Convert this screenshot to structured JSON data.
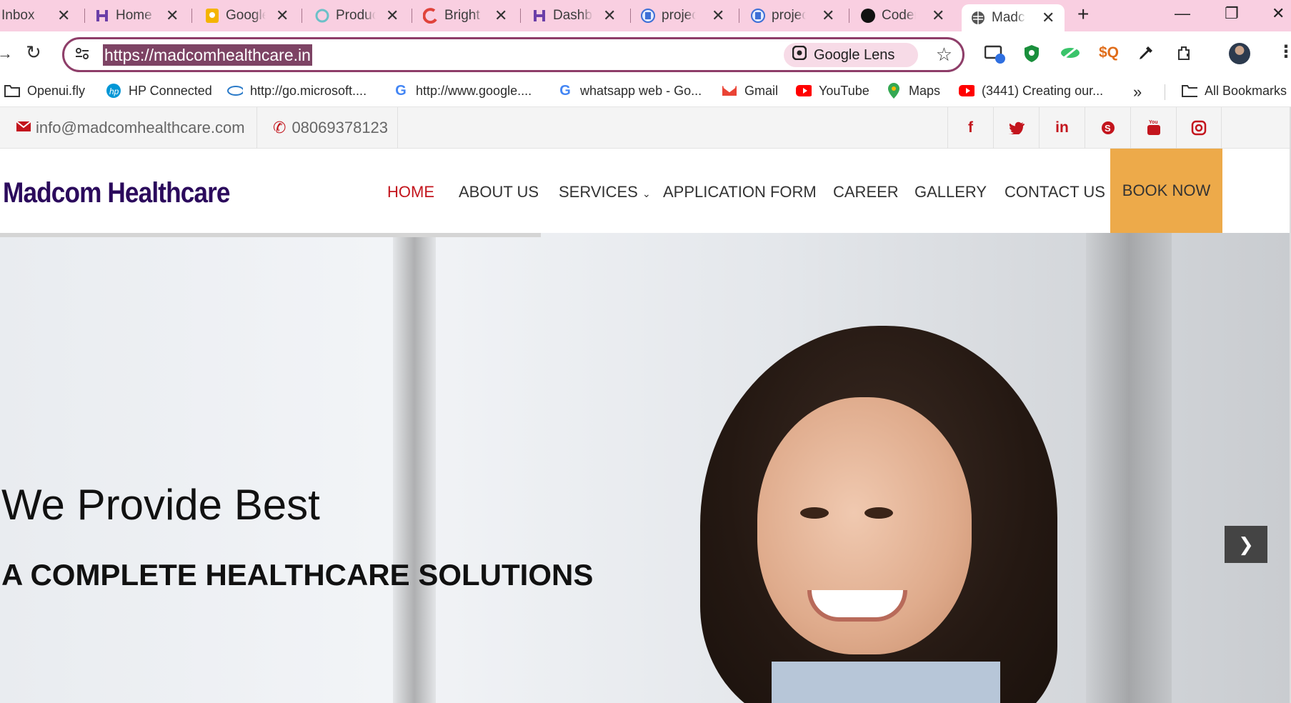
{
  "tabs": [
    {
      "title": "Inbox",
      "icon": "gmail-icon"
    },
    {
      "title": "Home",
      "icon": "home-app-icon"
    },
    {
      "title": "Google",
      "icon": "google-keep-icon"
    },
    {
      "title": "Products",
      "icon": "products-icon"
    },
    {
      "title": "Bright",
      "icon": "bright-icon"
    },
    {
      "title": "Dashboard",
      "icon": "dashboard-icon"
    },
    {
      "title": "project",
      "icon": "project-icon"
    },
    {
      "title": "project",
      "icon": "project-icon"
    },
    {
      "title": "Coder",
      "icon": "coder-icon"
    },
    {
      "title": "Madcom",
      "icon": "globe-icon"
    }
  ],
  "address": {
    "url": "https://madcomhealthcare.in",
    "lens_label": "Google Lens"
  },
  "bookmarks": [
    {
      "label": "Openui.fly",
      "icon": "folder-icon"
    },
    {
      "label": "HP Connected",
      "icon": "hp-icon"
    },
    {
      "label": "http://go.microsoft....",
      "icon": "msn-icon"
    },
    {
      "label": "http://www.google....",
      "icon": "google-icon"
    },
    {
      "label": "whatsapp web - Go...",
      "icon": "google-icon"
    },
    {
      "label": "Gmail",
      "icon": "gmail-icon"
    },
    {
      "label": "YouTube",
      "icon": "youtube-icon"
    },
    {
      "label": "Maps",
      "icon": "maps-icon"
    },
    {
      "label": "(3441) Creating our...",
      "icon": "youtube-icon"
    }
  ],
  "all_bookmarks": "All Bookmarks",
  "topbar": {
    "email": "info@madcomhealthcare.com",
    "phone": "08069378123"
  },
  "social": [
    {
      "label": "f",
      "icon": "facebook-icon"
    },
    {
      "label": "t",
      "icon": "twitter-icon"
    },
    {
      "label": "in",
      "icon": "linkedin-icon"
    },
    {
      "label": "S",
      "icon": "skype-icon"
    },
    {
      "label": "▶",
      "icon": "youtube-icon"
    },
    {
      "label": "◎",
      "icon": "instagram-icon"
    }
  ],
  "site": {
    "logo": "Madcom Healthcare",
    "book_now": "BOOK NOW"
  },
  "nav": [
    "HOME",
    "ABOUT US",
    "SERVICES",
    "APPLICATION FORM",
    "CAREER",
    "GALLERY",
    "CONTACT US"
  ],
  "hero": {
    "title": "We Provide Best",
    "subtitle": "A COMPLETE HEALTHCARE SOLUTIONS"
  },
  "colors": {
    "accent": "#c3151d",
    "brand": "#2b0a5c",
    "book": "#edaa4a",
    "tabstrip": "#f9cfe1"
  }
}
